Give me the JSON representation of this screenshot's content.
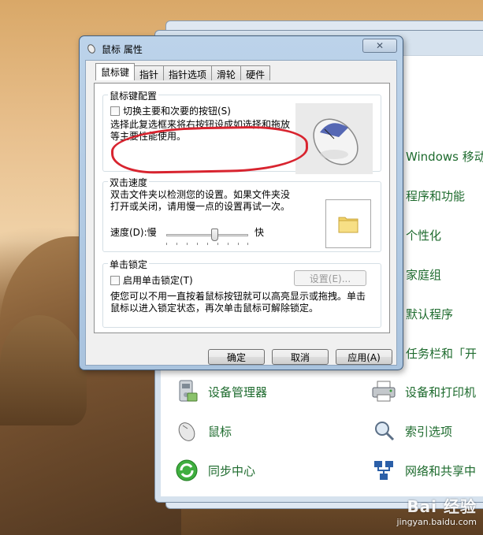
{
  "dialog": {
    "title": "鼠标 属性",
    "close_glyph": "✕",
    "tabs": [
      {
        "label": "鼠标键",
        "active": true
      },
      {
        "label": "指针",
        "active": false
      },
      {
        "label": "指针选项",
        "active": false
      },
      {
        "label": "滑轮",
        "active": false
      },
      {
        "label": "硬件",
        "active": false
      }
    ],
    "button_config": {
      "title": "鼠标键配置",
      "checkbox_label": "切换主要和次要的按钮(S)",
      "checked": false,
      "desc_line1": "选择此复选框来将右按钮设成如选择和拖放",
      "desc_line2": "等主要性能使用。"
    },
    "double_click": {
      "title": "双击速度",
      "desc_line1": "双击文件夹以检测您的设置。如果文件夹没",
      "desc_line2": "打开或关闭，请用慢一点的设置再试一次。",
      "speed_label": "速度(D):慢",
      "fast_label": "快",
      "speed_level": 0.6
    },
    "click_lock": {
      "title": "单击锁定",
      "checkbox_label": "启用单击锁定(T)",
      "checked": false,
      "settings_button": "设置(E)...",
      "desc_line1": "使您可以不用一直按着鼠标按钮就可以高亮显示或拖拽。单击",
      "desc_line2": "鼠标以进入锁定状态，再次单击鼠标可解除锁定。"
    },
    "buttons": {
      "ok": "确定",
      "cancel": "取消",
      "apply": "应用(A)"
    }
  },
  "control_panel": {
    "right_links": [
      "Windows 移动",
      "程序和功能",
      "个性化",
      "家庭组",
      "默认程序",
      "任务栏和「开"
    ],
    "items": [
      {
        "label": "设备管理器",
        "icon": "device-manager-icon"
      },
      {
        "label": "设备和打印机",
        "icon": "printer-icon"
      },
      {
        "label": "鼠标",
        "icon": "mouse-icon"
      },
      {
        "label": "索引选项",
        "icon": "index-search-icon"
      },
      {
        "label": "同步中心",
        "icon": "sync-icon"
      },
      {
        "label": "网络和共享中",
        "icon": "network-icon"
      }
    ]
  },
  "watermark": {
    "logo": "Bai 经验",
    "url": "jingyan.baidu.com"
  },
  "colors": {
    "highlight": "#d8242f",
    "link_green": "#1e6b2e",
    "dialog_frame": "#a9c3de"
  }
}
